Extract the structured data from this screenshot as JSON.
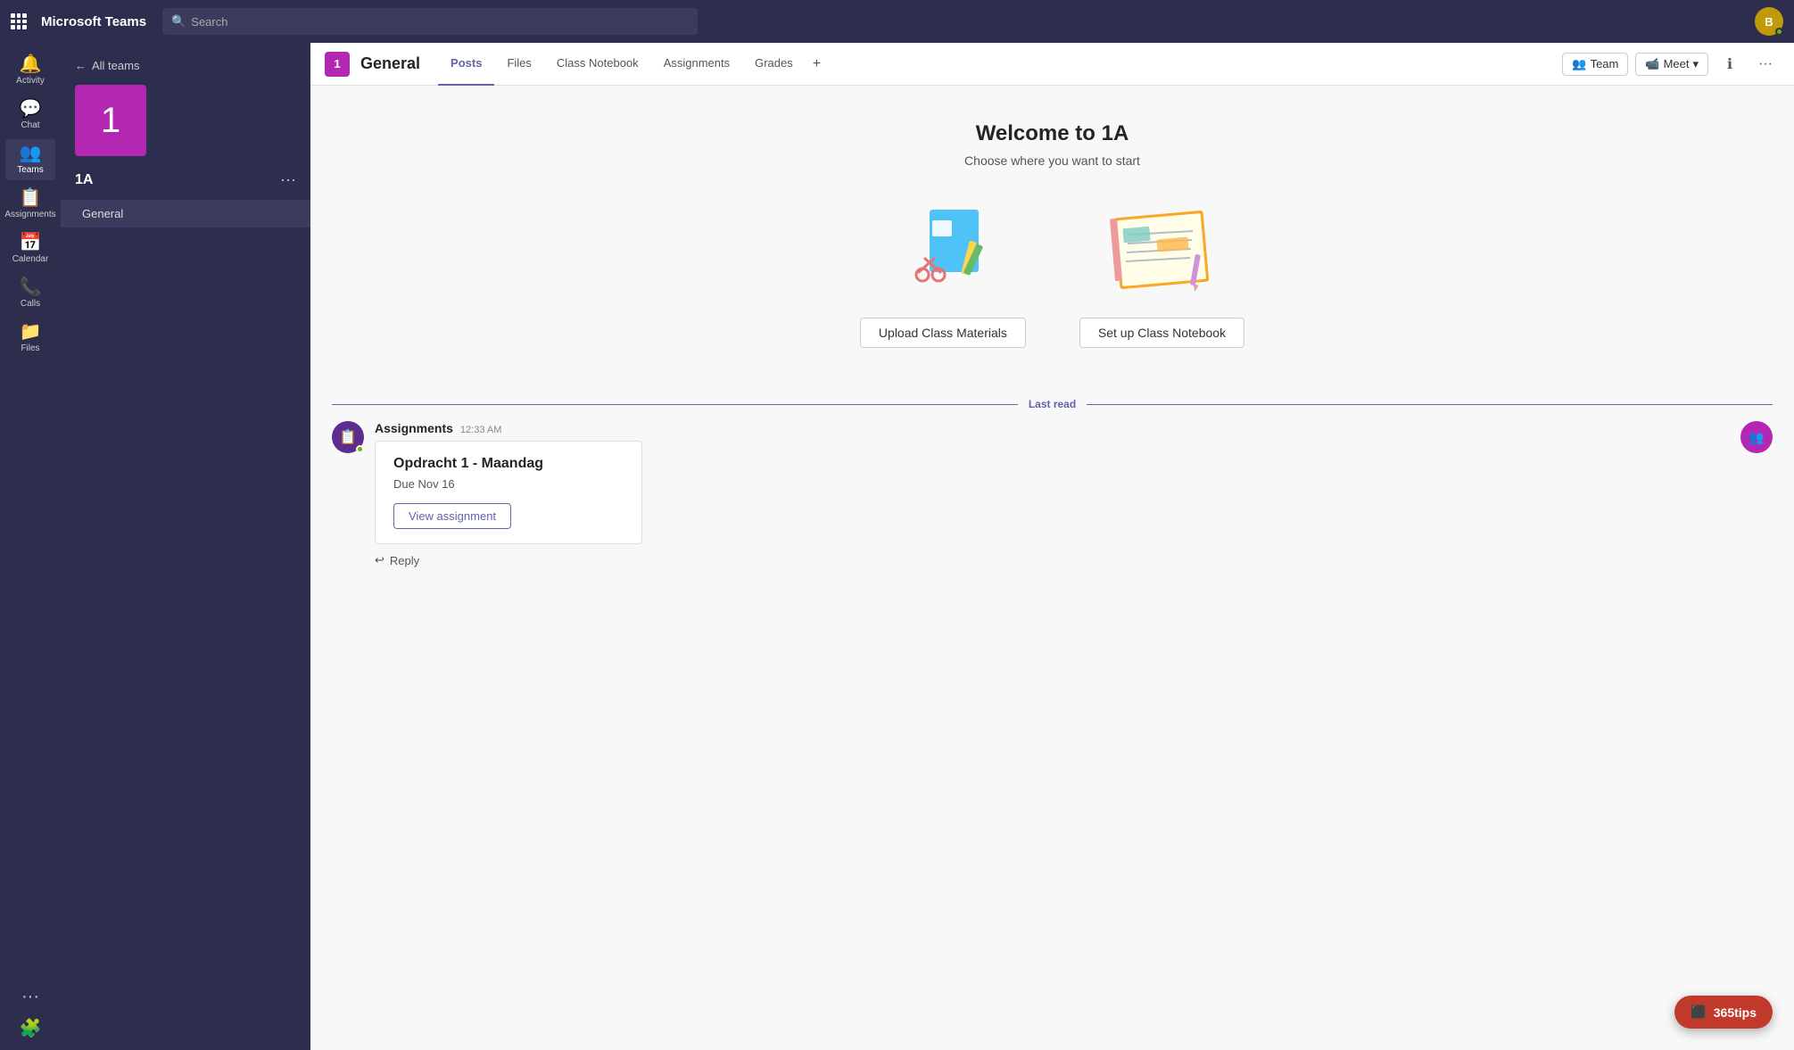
{
  "app": {
    "name": "Microsoft Teams"
  },
  "search": {
    "placeholder": "Search"
  },
  "left_nav": {
    "items": [
      {
        "id": "activity",
        "label": "Activity",
        "icon": "🔔"
      },
      {
        "id": "chat",
        "label": "Chat",
        "icon": "💬"
      },
      {
        "id": "teams",
        "label": "Teams",
        "icon": "👥"
      },
      {
        "id": "assignments",
        "label": "Assignments",
        "icon": "📋"
      },
      {
        "id": "calendar",
        "label": "Calendar",
        "icon": "📅"
      },
      {
        "id": "calls",
        "label": "Calls",
        "icon": "📞"
      },
      {
        "id": "files",
        "label": "Files",
        "icon": "📁"
      },
      {
        "id": "more",
        "label": "···",
        "icon": "···"
      }
    ],
    "active": "teams"
  },
  "sidebar": {
    "back_label": "All teams",
    "team_number": "1",
    "team_name": "1A",
    "channels": [
      {
        "label": "General"
      }
    ]
  },
  "channel": {
    "badge": "1",
    "name": "General",
    "tabs": [
      {
        "id": "posts",
        "label": "Posts",
        "active": true
      },
      {
        "id": "files",
        "label": "Files",
        "active": false
      },
      {
        "id": "notebook",
        "label": "Class Notebook",
        "active": false
      },
      {
        "id": "assignments",
        "label": "Assignments",
        "active": false
      },
      {
        "id": "grades",
        "label": "Grades",
        "active": false
      }
    ],
    "header_actions": {
      "team_label": "Team",
      "meet_label": "Meet"
    }
  },
  "welcome": {
    "title": "Welcome to 1A",
    "subtitle": "Choose where you want to start",
    "cards": [
      {
        "id": "upload",
        "btn_label": "Upload Class Materials"
      },
      {
        "id": "notebook",
        "btn_label": "Set up Class Notebook"
      }
    ]
  },
  "last_read": {
    "label": "Last read"
  },
  "message": {
    "sender": "Assignments",
    "time": "12:33 AM",
    "assignment_title": "Opdracht 1 - Maandag",
    "assignment_due": "Due Nov 16",
    "view_btn": "View assignment",
    "reply_label": "Reply"
  },
  "tips": {
    "label": "365tips"
  }
}
